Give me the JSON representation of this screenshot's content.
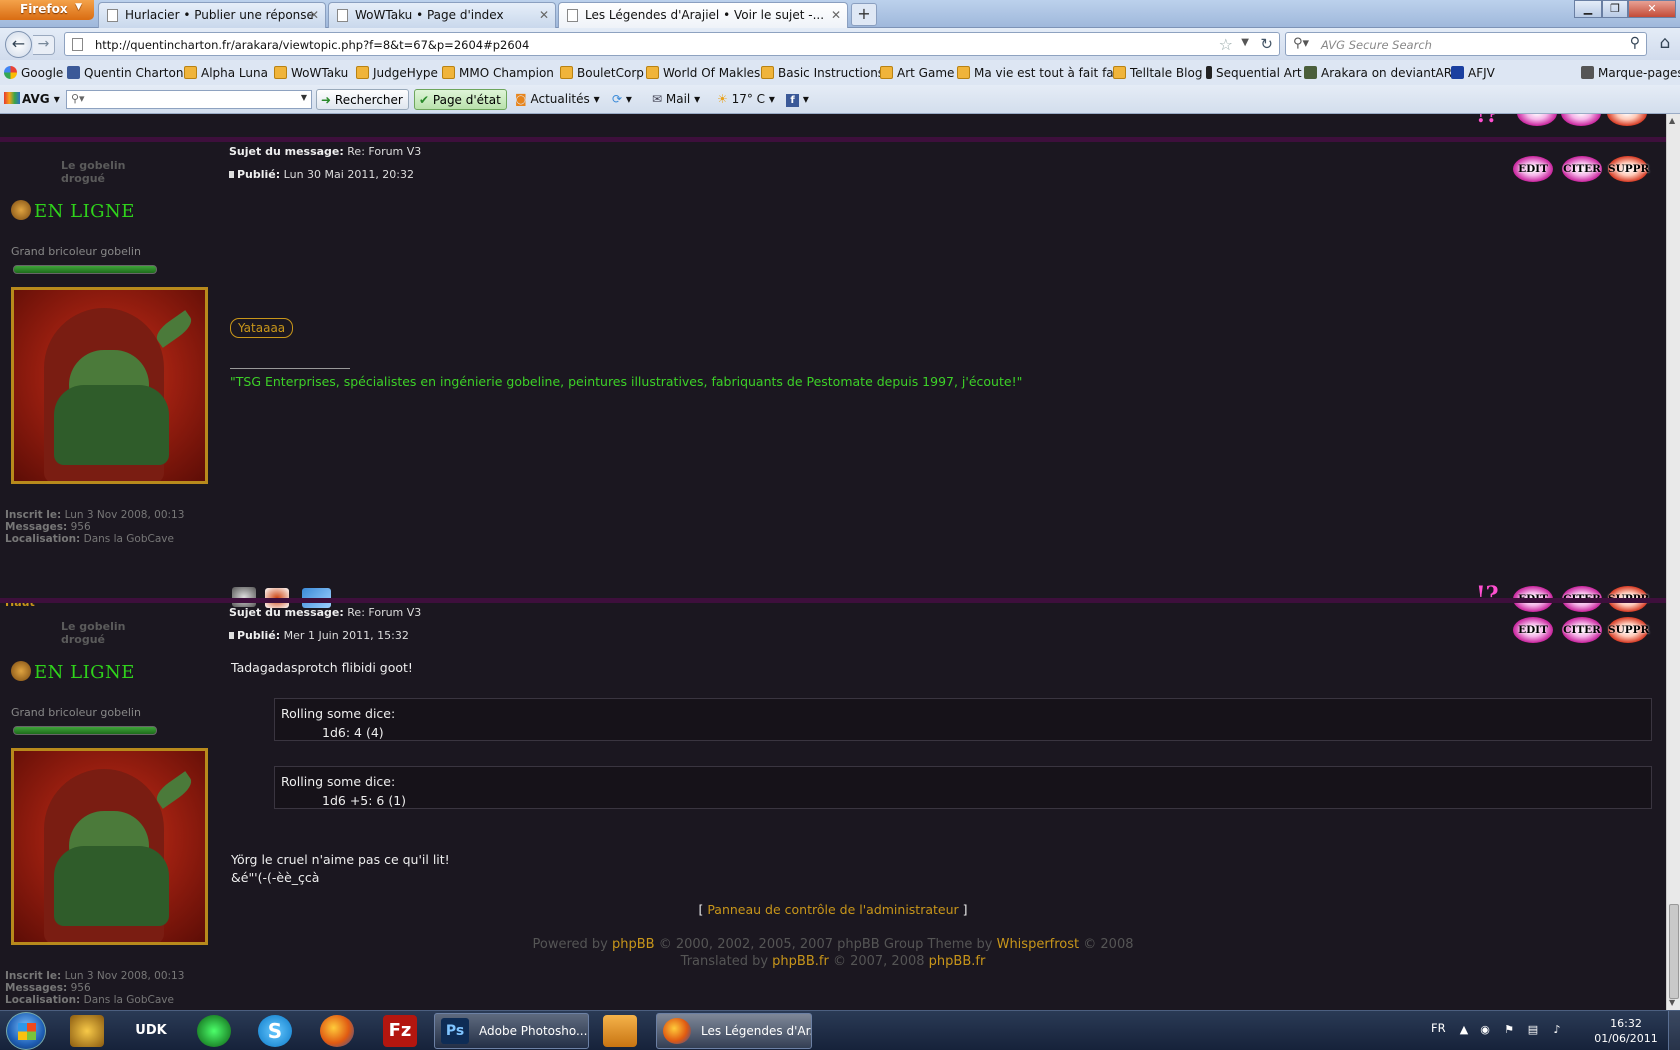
{
  "browser": {
    "firefox_label": "Firefox",
    "tabs": [
      {
        "title": "Hurlacier • Publier une réponse",
        "active": false
      },
      {
        "title": "WoWTaku • Page d'index",
        "active": false
      },
      {
        "title": "Les Légendes d'Arajiel • Voir le sujet -...",
        "active": true
      }
    ],
    "url": "http://quentincharton.fr/arakara/viewtopic.php?f=8&t=67&p=2604#p2604",
    "search_placeholder": "AVG Secure Search"
  },
  "bookmarks": [
    {
      "label": "Google",
      "icon": "google-icon"
    },
    {
      "label": "Quentin Charton",
      "icon": "facebook-icon"
    },
    {
      "label": "Alpha Luna",
      "icon": "feed-icon"
    },
    {
      "label": "WoWTaku",
      "icon": "feed-icon"
    },
    {
      "label": "JudgeHype",
      "icon": "feed-icon"
    },
    {
      "label": "MMO Champion",
      "icon": "feed-icon"
    },
    {
      "label": "BouletCorp",
      "icon": "feed-icon"
    },
    {
      "label": "World Of Makles",
      "icon": "feed-icon"
    },
    {
      "label": "Basic Instructions",
      "icon": "feed-icon"
    },
    {
      "label": "Art Game",
      "icon": "feed-icon"
    },
    {
      "label": "Ma vie est tout à fait fa...",
      "icon": "feed-icon"
    },
    {
      "label": "Telltale Blog",
      "icon": "feed-icon"
    },
    {
      "label": "Sequential Art",
      "icon": "key-icon"
    },
    {
      "label": "Arakara on deviantART",
      "icon": "deviantart-icon"
    },
    {
      "label": "AFJV",
      "icon": "afjv-icon"
    }
  ],
  "bookmarks_menu": "Marque-pages",
  "avg": {
    "logo": "AVG",
    "rechercher": "Rechercher",
    "page_etat": "Page d'état",
    "actualites": "Actualités",
    "mail": "Mail",
    "weather": "17° C"
  },
  "posts": [
    {
      "author": "Le gobelin drogué",
      "online": "EN LIGNE",
      "rank": "Grand bricoleur gobelin",
      "subject_label": "Sujet du message:",
      "subject": "Re: Forum V3",
      "published_label": "Publié:",
      "published": "Lun 30 Mai 2011, 20:32",
      "body": "Yataaaa",
      "signature": "\"TSG Enterprises, spécialistes en ingénierie gobeline, peintures illustratives, fabriquants de Pestomate depuis 1997, j'écoute!\"",
      "registered_label": "Inscrit le:",
      "registered": "Lun 3 Nov 2008, 00:13",
      "messages_label": "Messages:",
      "messages": "956",
      "location_label": "Localisation:",
      "location": "Dans la GobCave",
      "top_link": "Haut"
    },
    {
      "author": "Le gobelin drogué",
      "online": "EN LIGNE",
      "rank": "Grand bricoleur gobelin",
      "subject_label": "Sujet du message:",
      "subject": "Re: Forum V3",
      "published_label": "Publié:",
      "published": "Mer 1 Juin 2011, 15:32",
      "body_intro": "Tadagadasprotch flibidi goot!",
      "dice": [
        {
          "title": "Rolling some dice:",
          "roll": "1d6: 4 (4)"
        },
        {
          "title": "Rolling some dice:",
          "roll": "1d6 +5: 6 (1)"
        }
      ],
      "body_outro_1": "Yörg le cruel n'aime pas ce qu'il lit!",
      "body_outro_2": "&é\"'(-(-èè_çcà",
      "registered_label": "Inscrit le:",
      "registered": "Lun 3 Nov 2008, 00:13",
      "messages_label": "Messages:",
      "messages": "956",
      "location_label": "Localisation:",
      "location": "Dans la GobCave"
    }
  ],
  "post_buttons": {
    "edit": "EDIT",
    "quote": "CITER",
    "delete": "SUPPR"
  },
  "footer": {
    "admin_link": "Panneau de contrôle de l'administrateur",
    "powered_prefix": "Powered by",
    "phpbb": "phpBB",
    "powered_mid": "© 2000, 2002, 2005, 2007 phpBB Group Theme by",
    "theme_author": "Whisperfrost",
    "powered_suffix": "© 2008",
    "translated_prefix": "Translated by",
    "translated_site": "phpBB.fr",
    "translated_mid": "© 2007, 2008",
    "translated_site2": "phpBB.fr"
  },
  "taskbar": {
    "tasks": [
      {
        "label": "Adobe Photosho...",
        "icon": "photoshop-icon"
      },
      {
        "label": "Les Légendes d'Ar...",
        "icon": "firefox-icon"
      }
    ],
    "udk": "UDK",
    "lang": "FR",
    "time": "16:32",
    "date": "01/06/2011"
  }
}
